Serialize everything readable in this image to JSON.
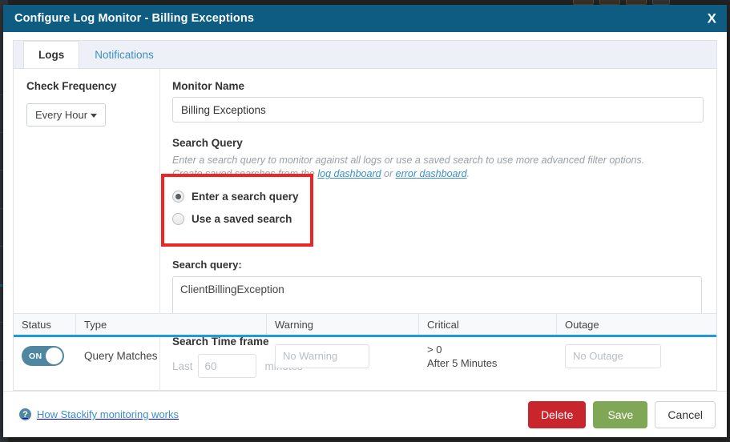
{
  "window": {
    "title": "Configure Log Monitor - Billing Exceptions",
    "close_label": "X",
    "titlebar_color": "#0f5c82"
  },
  "tabs": [
    {
      "label": "Logs",
      "active": true
    },
    {
      "label": "Notifications",
      "active": false
    }
  ],
  "left_column": {
    "check_frequency_label": "Check Frequency",
    "frequency_value": "Every Hour"
  },
  "monitor_name": {
    "label": "Monitor Name",
    "value": "Billing Exceptions"
  },
  "search_query_section": {
    "heading": "Search Query",
    "help_line1": "Enter a search query to monitor against all logs or use a saved search to use more advanced filter options.",
    "help_line2_prefix": "Create saved searches from the ",
    "link1": "log dashboard",
    "help_line2_mid": " or ",
    "link2": "error dashboard",
    "help_line2_suffix": ".",
    "options": [
      {
        "label": "Enter a search query",
        "selected": true
      },
      {
        "label": "Use a saved search",
        "selected": false
      }
    ],
    "query_label": "Search query:",
    "query_value": "ClientBillingException",
    "annotation_color": "#ec2626"
  },
  "time_frame": {
    "label": "Search Time frame",
    "last_label": "Last",
    "minutes_value": "60",
    "minutes_unit": "minutes"
  },
  "alerts_table": {
    "columns": [
      "Status",
      "Type",
      "Warning",
      "Critical",
      "Outage"
    ],
    "accent_color": "#1f9bd8",
    "rows": [
      {
        "status_toggle": "ON",
        "status_on": true,
        "type": "Query Matches",
        "warning": "No Warning",
        "critical_threshold": "> 0",
        "critical_duration": "After 5 Minutes",
        "outage": "No Outage"
      }
    ]
  },
  "footer": {
    "help_icon": "question-mark-icon",
    "help_text": "How Stackify monitoring works",
    "delete_label": "Delete",
    "save_label": "Save",
    "cancel_label": "Cancel",
    "delete_color": "#c9252d",
    "save_color": "#7fa756"
  }
}
